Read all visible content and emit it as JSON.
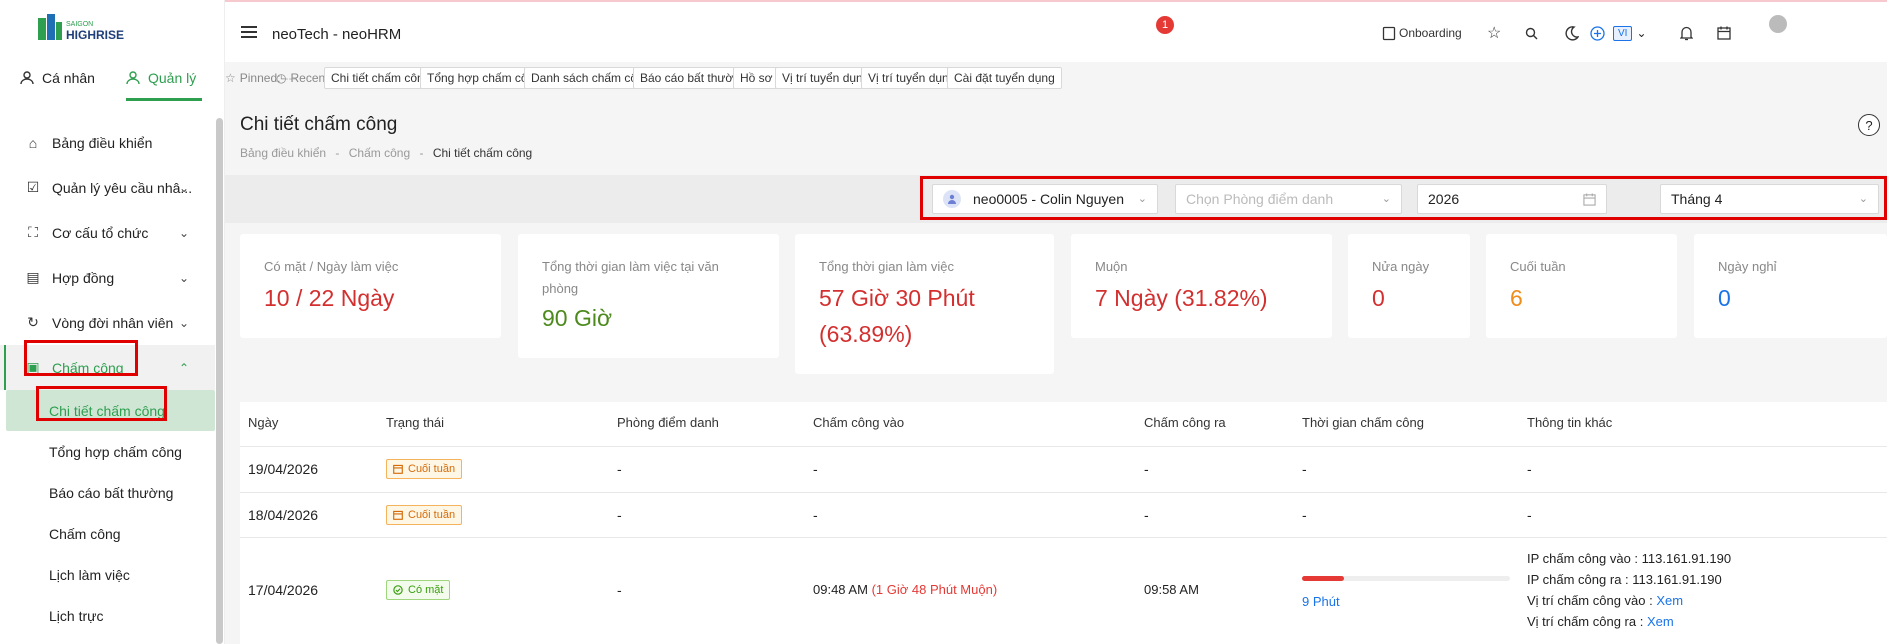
{
  "header": {
    "app_title": "neoTech - neoHRM",
    "onboarding_label": "Onboarding",
    "onboarding_badge": "1",
    "language": "VI"
  },
  "sidebar": {
    "tabs": [
      {
        "label": "Cá nhân"
      },
      {
        "label": "Quản lý"
      }
    ],
    "items": [
      {
        "label": "Bảng điều khiển"
      },
      {
        "label": "Quản lý yêu cầu nhâ..."
      },
      {
        "label": "Cơ cấu tổ chức"
      },
      {
        "label": "Hợp đồng"
      },
      {
        "label": "Vòng đời nhân viên"
      },
      {
        "label": "Chấm công"
      }
    ],
    "subitems": [
      {
        "label": "Chi tiết chấm công"
      },
      {
        "label": "Tổng hợp chấm công"
      },
      {
        "label": "Báo cáo bất thường"
      },
      {
        "label": "Chấm công"
      },
      {
        "label": "Lịch làm việc"
      },
      {
        "label": "Lịch trực"
      }
    ]
  },
  "pinbar": {
    "pinned_label": "Pinned:",
    "pinned_value": "---",
    "recent_label": "Recent:",
    "recent": [
      "Chi tiết chấm công",
      "Tổng hợp chấm công",
      "Danh sách chấm công",
      "Báo cáo bất thường",
      "Hồ sơ",
      "Vị trí tuyển dụng",
      "Vị trí tuyển dụng",
      "Cài đặt tuyển dụng"
    ]
  },
  "page": {
    "title": "Chi tiết chấm công",
    "breadcrumb": [
      "Bảng điều khiển",
      "Chấm công",
      "Chi tiết chấm công"
    ],
    "breadcrumb_sep": "-"
  },
  "filters": {
    "employee": "neo0005 - Colin Nguyen",
    "room_placeholder": "Chọn Phòng điểm danh",
    "year": "2026",
    "month": "Tháng 4"
  },
  "cards": [
    {
      "label": "Có mặt / Ngày làm việc",
      "value": "10 / 22 Ngày",
      "color": "#d32f2f"
    },
    {
      "label": "Tổng thời gian làm việc tại văn phòng",
      "value": "90 Giờ",
      "color": "#4c8a1e"
    },
    {
      "label": "Tổng thời gian làm việc",
      "value": "57 Giờ 30 Phút (63.89%)",
      "color": "#d32f2f"
    },
    {
      "label": "Muộn",
      "value": "7 Ngày (31.82%)",
      "color": "#d32f2f"
    },
    {
      "label": "Nửa ngày",
      "value": "0",
      "color": "#d32f2f"
    },
    {
      "label": "Cuối tuần",
      "value": "6",
      "color": "#f08c1a"
    },
    {
      "label": "Ngày nghỉ",
      "value": "0",
      "color": "#1a73e8"
    }
  ],
  "table": {
    "headers": [
      "Ngày",
      "Trạng thái",
      "Phòng điểm danh",
      "Chấm công vào",
      "Chấm công ra",
      "Thời gian chấm công",
      "Thông tin khác"
    ],
    "rows": [
      {
        "date": "19/04/2026",
        "status": "Cuối tuần",
        "room": "-",
        "in": "-",
        "out": "-",
        "duration": "-",
        "info": "-"
      },
      {
        "date": "18/04/2026",
        "status": "Cuối tuần",
        "room": "-",
        "in": "-",
        "out": "-",
        "duration": "-",
        "info": "-"
      },
      {
        "date": "17/04/2026",
        "status": "Có mặt",
        "room": "-",
        "in": "09:48 AM",
        "in_late": "(1 Giờ 48 Phút Muộn)",
        "out": "09:58 AM",
        "duration": "9 Phút",
        "duration_fraction": 0.2,
        "info_ip_in_label": "IP chấm công vào :",
        "info_ip_in": "113.161.91.190",
        "info_ip_out_label": "IP chấm công ra :",
        "info_ip_out": "113.161.91.190",
        "info_loc_in_label": "Vị trí chấm công vào :",
        "info_loc_out_label": "Vị trí chấm công ra :",
        "info_link": "Xem"
      }
    ]
  }
}
